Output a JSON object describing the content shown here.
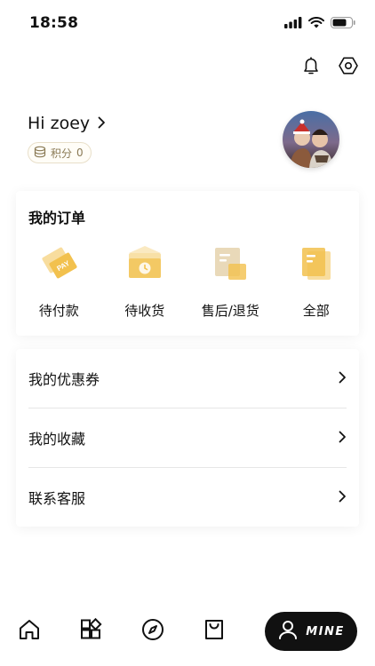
{
  "status_bar": {
    "time": "18:58"
  },
  "profile": {
    "greeting": "Hi zoey",
    "points_label": "积分",
    "points_value": "0"
  },
  "orders": {
    "title": "我的订单",
    "items": [
      {
        "label": "待付款",
        "icon": "pay-icon"
      },
      {
        "label": "待收货",
        "icon": "delivery-icon"
      },
      {
        "label": "售后/退货",
        "icon": "after-sales-icon"
      },
      {
        "label": "全部",
        "icon": "all-orders-icon"
      }
    ]
  },
  "menu": {
    "items": [
      {
        "label": "我的优惠券"
      },
      {
        "label": "我的收藏"
      },
      {
        "label": "联系客服"
      }
    ]
  },
  "tabbar": {
    "tabs": [
      {
        "icon": "home-icon"
      },
      {
        "icon": "category-icon"
      },
      {
        "icon": "discover-icon"
      },
      {
        "icon": "bag-icon"
      }
    ],
    "active_label": "MINE"
  },
  "colors": {
    "accent_gold": "#f2c14e",
    "text": "#111111",
    "badge_border": "#e8dfc9"
  },
  "icon_text": {
    "pay": "PAY"
  }
}
